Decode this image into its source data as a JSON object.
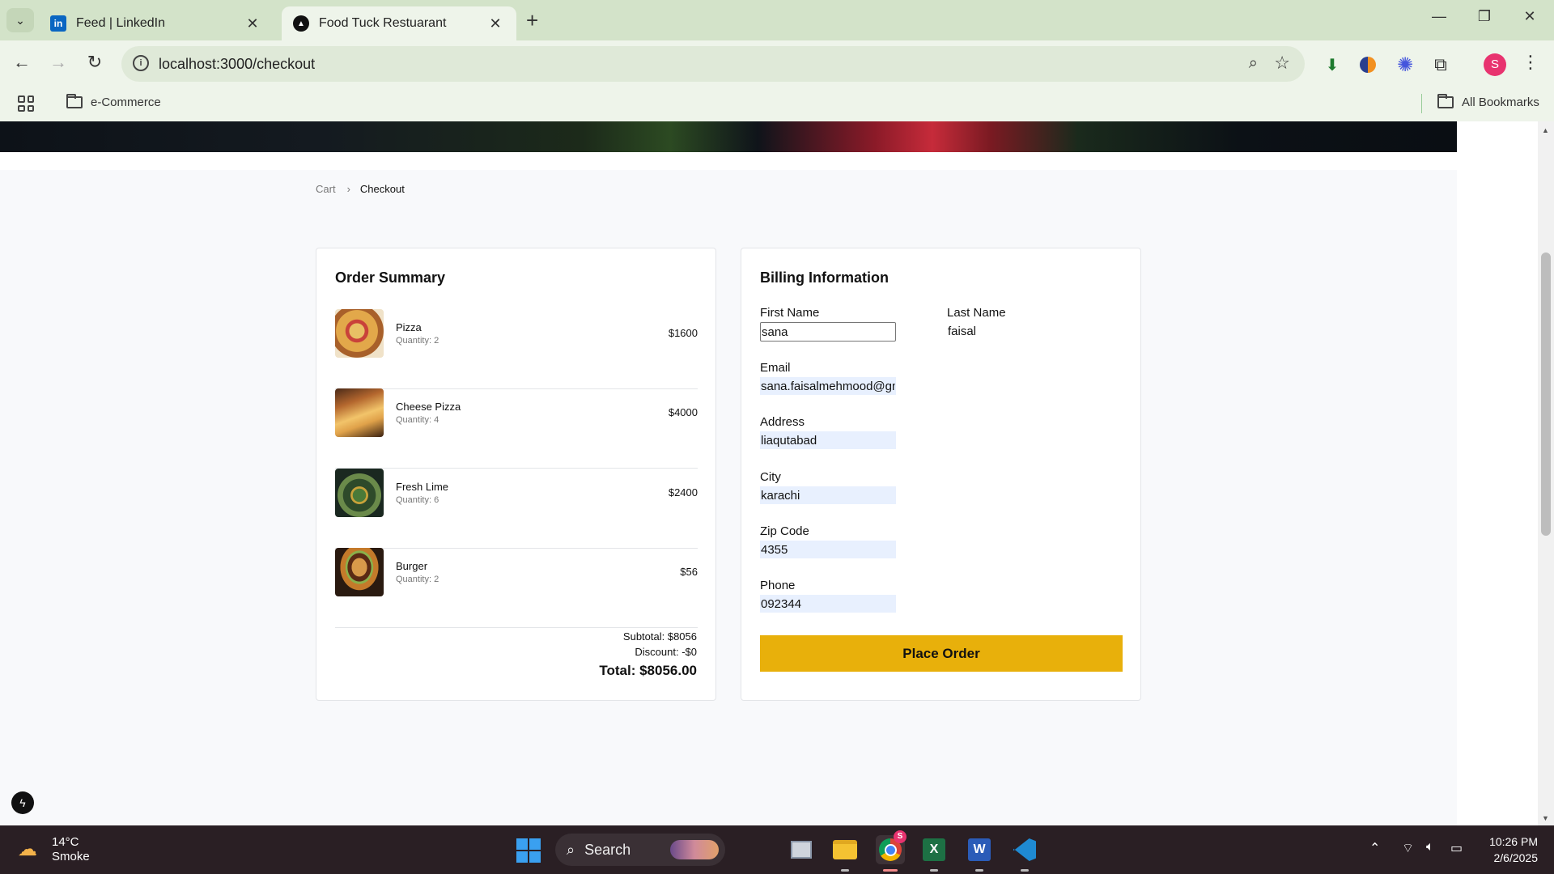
{
  "browser": {
    "tabs": [
      {
        "label": "Feed | LinkedIn",
        "favicon": "linkedin-icon",
        "active": false
      },
      {
        "label": "Food Tuck Restuarant",
        "favicon": "nextjs-icon",
        "active": true
      }
    ],
    "url": "localhost:3000/checkout",
    "bookmarks": {
      "folder": "e-Commerce",
      "all": "All Bookmarks"
    },
    "profile_initial": "S"
  },
  "breadcrumb": {
    "parent": "Cart",
    "current": "Checkout"
  },
  "order_summary": {
    "title": "Order Summary",
    "items": [
      {
        "name": "Pizza",
        "quantity": "Quantity: 2",
        "price": "$1600"
      },
      {
        "name": "Cheese Pizza",
        "quantity": "Quantity: 4",
        "price": "$4000"
      },
      {
        "name": "Fresh Lime",
        "quantity": "Quantity: 6",
        "price": "$2400"
      },
      {
        "name": "Burger",
        "quantity": "Quantity: 2",
        "price": "$56"
      }
    ],
    "subtotal": "Subtotal: $8056",
    "discount": "Discount: -$0",
    "total": "Total: $8056.00"
  },
  "billing": {
    "title": "Billing Information",
    "first_name": {
      "label": "First Name",
      "value": "sana"
    },
    "last_name": {
      "label": "Last Name",
      "value": "faisal"
    },
    "email": {
      "label": "Email",
      "value": "sana.faisalmehmood@gmail.com"
    },
    "address": {
      "label": "Address",
      "value": "liaqutabad"
    },
    "city": {
      "label": "City",
      "value": "karachi"
    },
    "zip": {
      "label": "Zip Code",
      "value": "4355"
    },
    "phone": {
      "label": "Phone",
      "value": "092344"
    },
    "submit": "Place Order"
  },
  "colors": {
    "accent": "#e8b00b",
    "autofill": "#e8f0fe"
  },
  "taskbar": {
    "weather_temp": "14°C",
    "weather_desc": "Smoke",
    "search": "Search",
    "chrome_badge": "S",
    "time": "10:26 PM",
    "date": "2/6/2025"
  }
}
